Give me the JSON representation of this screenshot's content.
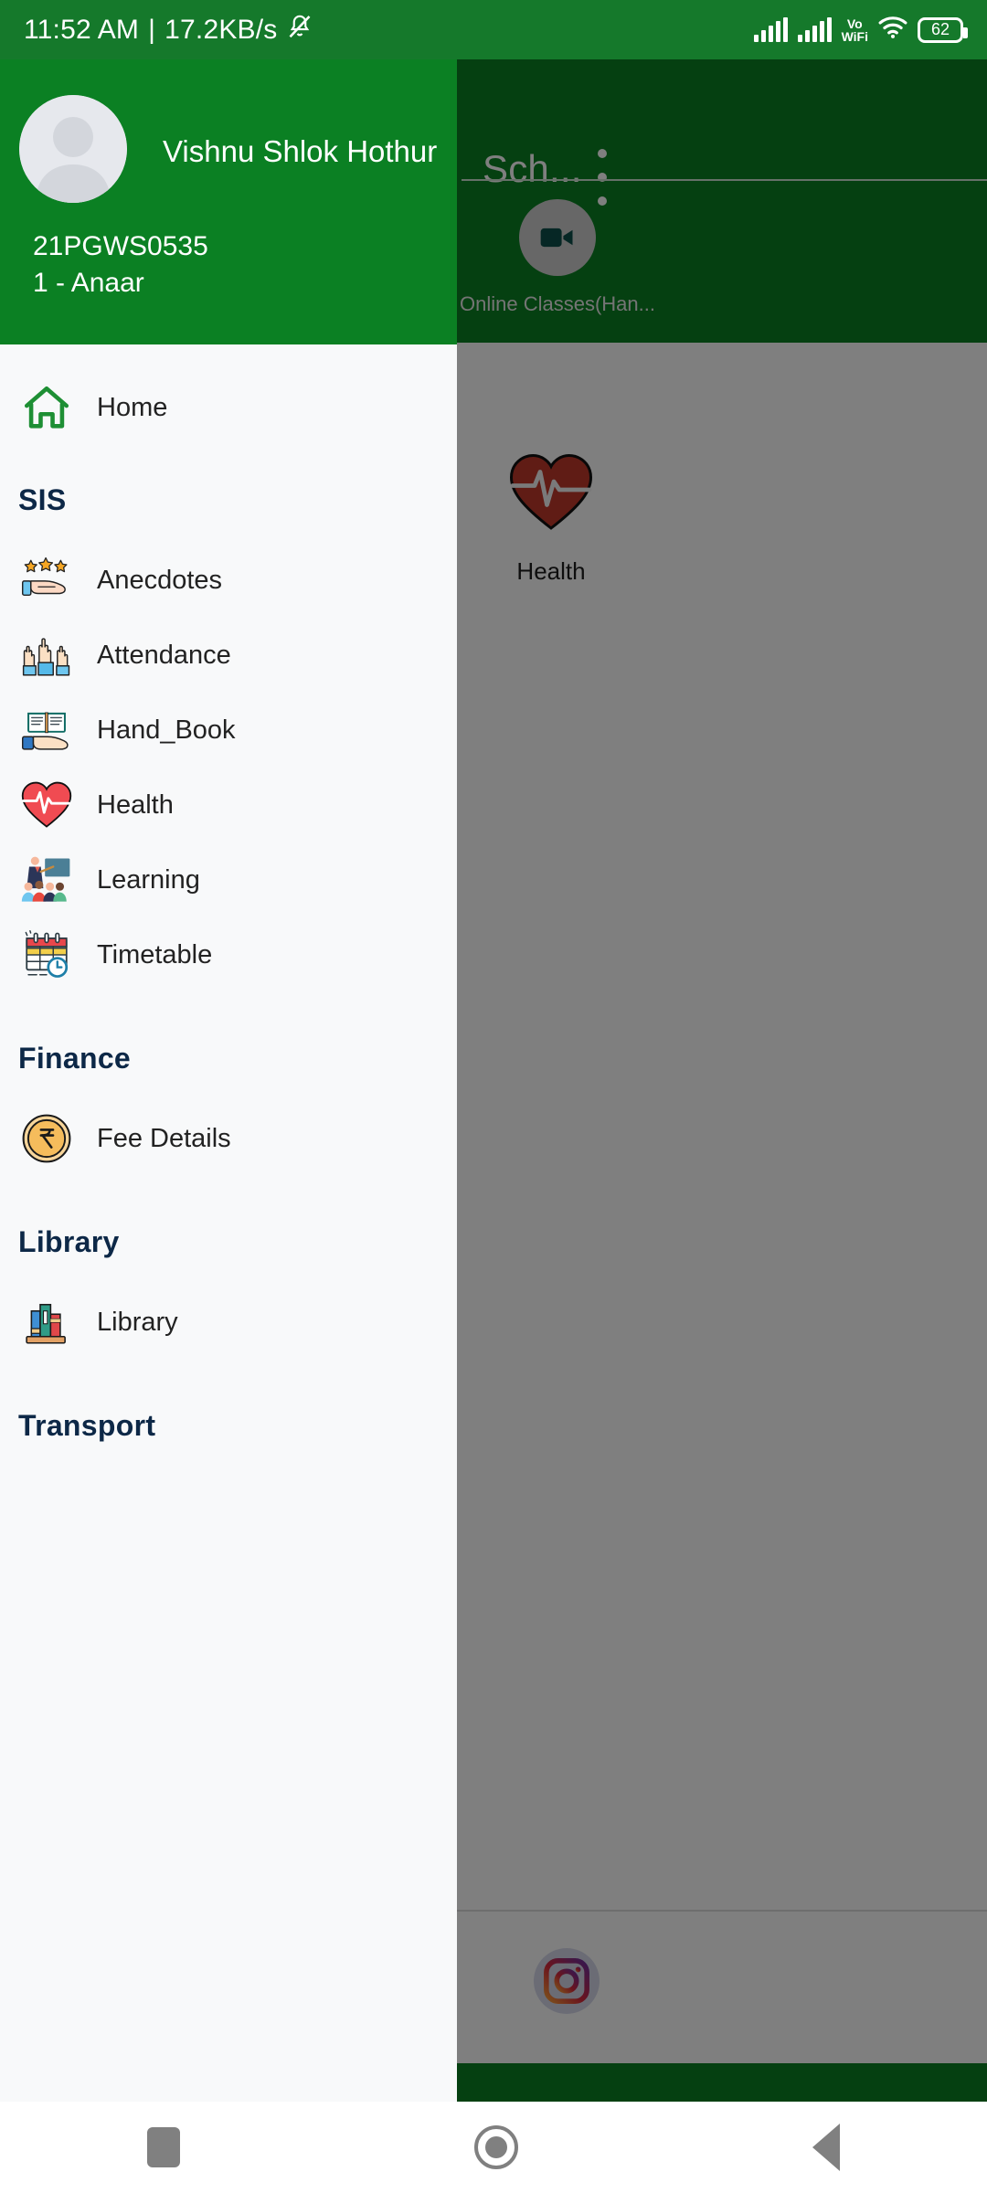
{
  "status_bar": {
    "time": "11:52 AM",
    "separator": "|",
    "network_speed": "17.2KB/s",
    "mute_icon": "bell-muted-icon",
    "signal_1_icon": "signal-bars-icon",
    "signal_2_icon": "signal-bars-icon",
    "volte_top": "Vo",
    "volte_bottom": "WiFi",
    "wifi_icon": "wifi-icon",
    "battery_level": "62"
  },
  "background_app": {
    "appbar_title": "Sch...",
    "overflow_icon": "overflow-menu-icon",
    "tiles": [
      {
        "label": "Online Classes(Han...",
        "icon": "video-camera-icon"
      },
      {
        "label": "Health",
        "icon": "heart-pulse-icon"
      }
    ],
    "bottom_bar": {
      "instagram_icon": "instagram-icon"
    }
  },
  "drawer": {
    "profile": {
      "avatar_icon": "default-avatar-icon",
      "name": "Vishnu Shlok Hothur",
      "student_id": "21PGWS0535",
      "class": "1 - Anaar"
    },
    "home": {
      "label": "Home",
      "icon": "home-icon"
    },
    "sections": [
      {
        "title": "SIS",
        "items": [
          {
            "label": "Anecdotes",
            "icon": "stars-hand-icon"
          },
          {
            "label": "Attendance",
            "icon": "raised-hands-icon"
          },
          {
            "label": "Hand_Book",
            "icon": "book-hand-icon"
          },
          {
            "label": "Health",
            "icon": "heart-pulse-icon"
          },
          {
            "label": "Learning",
            "icon": "teacher-classroom-icon"
          },
          {
            "label": "Timetable",
            "icon": "calendar-clock-icon"
          }
        ]
      },
      {
        "title": "Finance",
        "items": [
          {
            "label": "Fee Details",
            "icon": "rupee-coin-icon"
          }
        ]
      },
      {
        "title": "Library",
        "items": [
          {
            "label": "Library",
            "icon": "books-shelf-icon"
          }
        ]
      },
      {
        "title": "Transport",
        "items": []
      }
    ]
  },
  "system_nav": {
    "recents_icon": "recents-square-icon",
    "home_icon": "home-circle-icon",
    "back_icon": "back-triangle-icon"
  },
  "colors": {
    "status_bar_green": "#15792b",
    "header_green": "#0b8023",
    "drawer_bg": "#f8f9fa",
    "section_header_navy": "#0d2847",
    "scrim": "rgba(0,0,0,0.50)"
  }
}
